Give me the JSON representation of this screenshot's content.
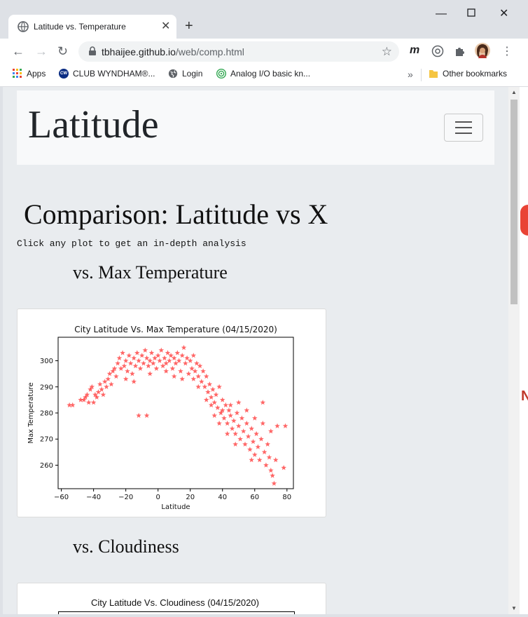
{
  "browser": {
    "tab_title": "Latitude vs. Temperature",
    "url_host": "tbhaijee.github.io",
    "url_path": "/web/comp.html",
    "bookmarks": [
      "Apps",
      "CLUB WYNDHAM®...",
      "Login",
      "Analog I/O basic kn..."
    ],
    "other_bookmarks": "Other bookmarks",
    "overflow": "»",
    "cw_badge": "CW"
  },
  "page": {
    "brand": "Latitude",
    "heading": "Comparison: Latitude vs X",
    "hint": "Click any plot to get an in-depth analysis",
    "section1": "vs. Max Temperature",
    "section2": "vs. Cloudiness",
    "plot2_title": "City Latitude Vs. Cloudiness (04/15/2020)"
  },
  "chart_data": {
    "type": "scatter",
    "title": "City Latitude Vs. Max Temperature (04/15/2020)",
    "xlabel": "Latitude",
    "ylabel": "Max Temperature",
    "xlim": [
      -62,
      84
    ],
    "ylim": [
      251,
      309
    ],
    "xticks": [
      -60,
      -40,
      -20,
      0,
      20,
      40,
      60,
      80
    ],
    "yticks": [
      260,
      270,
      280,
      290,
      300
    ],
    "marker": "star",
    "color": "#ff0000",
    "points": [
      [
        -55,
        283
      ],
      [
        -53,
        283
      ],
      [
        -46,
        285
      ],
      [
        -45,
        286
      ],
      [
        -44,
        287
      ],
      [
        -42,
        289
      ],
      [
        -41,
        290
      ],
      [
        -40,
        284
      ],
      [
        -38,
        286
      ],
      [
        -37,
        288
      ],
      [
        -36,
        291
      ],
      [
        -35,
        289
      ],
      [
        -34,
        287
      ],
      [
        -33,
        292
      ],
      [
        -32,
        290
      ],
      [
        -31,
        293
      ],
      [
        -30,
        295
      ],
      [
        -29,
        291
      ],
      [
        -28,
        296
      ],
      [
        -27,
        297
      ],
      [
        -26,
        294
      ],
      [
        -25,
        299
      ],
      [
        -24,
        301
      ],
      [
        -23,
        297
      ],
      [
        -22,
        303
      ],
      [
        -21,
        298
      ],
      [
        -20,
        300
      ],
      [
        -19,
        296
      ],
      [
        -18,
        302
      ],
      [
        -17,
        299
      ],
      [
        -16,
        295
      ],
      [
        -15,
        301
      ],
      [
        -14,
        298
      ],
      [
        -13,
        303
      ],
      [
        -12,
        300
      ],
      [
        -11,
        297
      ],
      [
        -10,
        302
      ],
      [
        -9,
        299
      ],
      [
        -8,
        304
      ],
      [
        -7,
        301
      ],
      [
        -6,
        298
      ],
      [
        -5,
        300
      ],
      [
        -4,
        303
      ],
      [
        -3,
        299
      ],
      [
        -2,
        301
      ],
      [
        -1,
        297
      ],
      [
        0,
        302
      ],
      [
        1,
        300
      ],
      [
        2,
        304
      ],
      [
        3,
        298
      ],
      [
        4,
        301
      ],
      [
        5,
        299
      ],
      [
        6,
        303
      ],
      [
        7,
        300
      ],
      [
        8,
        302
      ],
      [
        9,
        297
      ],
      [
        10,
        301
      ],
      [
        11,
        299
      ],
      [
        12,
        303
      ],
      [
        13,
        300
      ],
      [
        14,
        296
      ],
      [
        15,
        302
      ],
      [
        16,
        305
      ],
      [
        17,
        299
      ],
      [
        18,
        301
      ],
      [
        19,
        295
      ],
      [
        20,
        300
      ],
      [
        21,
        297
      ],
      [
        22,
        302
      ],
      [
        23,
        296
      ],
      [
        24,
        299
      ],
      [
        25,
        294
      ],
      [
        26,
        298
      ],
      [
        27,
        292
      ],
      [
        28,
        296
      ],
      [
        29,
        290
      ],
      [
        30,
        294
      ],
      [
        31,
        288
      ],
      [
        32,
        291
      ],
      [
        33,
        286
      ],
      [
        34,
        289
      ],
      [
        35,
        284
      ],
      [
        36,
        287
      ],
      [
        37,
        282
      ],
      [
        38,
        290
      ],
      [
        39,
        280
      ],
      [
        40,
        285
      ],
      [
        41,
        278
      ],
      [
        42,
        283
      ],
      [
        43,
        276
      ],
      [
        44,
        281
      ],
      [
        45,
        279
      ],
      [
        46,
        274
      ],
      [
        47,
        277
      ],
      [
        48,
        272
      ],
      [
        49,
        280
      ],
      [
        50,
        275
      ],
      [
        51,
        270
      ],
      [
        52,
        278
      ],
      [
        53,
        273
      ],
      [
        54,
        268
      ],
      [
        55,
        276
      ],
      [
        56,
        271
      ],
      [
        57,
        266
      ],
      [
        58,
        274
      ],
      [
        59,
        269
      ],
      [
        60,
        264
      ],
      [
        61,
        272
      ],
      [
        62,
        267
      ],
      [
        63,
        262
      ],
      [
        64,
        270
      ],
      [
        65,
        284
      ],
      [
        66,
        265
      ],
      [
        67,
        260
      ],
      [
        68,
        268
      ],
      [
        69,
        263
      ],
      [
        70,
        258
      ],
      [
        71,
        256
      ],
      [
        72,
        253
      ],
      [
        73,
        262
      ],
      [
        74,
        275
      ],
      [
        78,
        259
      ],
      [
        79,
        275
      ],
      [
        -12,
        279
      ],
      [
        -7,
        279
      ],
      [
        -48,
        285
      ],
      [
        -43,
        284
      ],
      [
        -39,
        287
      ],
      [
        15,
        293
      ],
      [
        22,
        293
      ],
      [
        30,
        285
      ],
      [
        35,
        279
      ],
      [
        40,
        281
      ],
      [
        45,
        283
      ],
      [
        55,
        281
      ],
      [
        60,
        278
      ],
      [
        65,
        276
      ],
      [
        70,
        273
      ],
      [
        50,
        284
      ],
      [
        43,
        272
      ],
      [
        -20,
        293
      ],
      [
        -15,
        292
      ],
      [
        -5,
        295
      ],
      [
        5,
        296
      ],
      [
        10,
        294
      ],
      [
        25,
        290
      ],
      [
        33,
        283
      ],
      [
        38,
        276
      ],
      [
        48,
        268
      ],
      [
        58,
        262
      ]
    ]
  },
  "colors": {
    "page_bg": "#e9ecef",
    "navbar_bg": "#f8f9fa",
    "marker": "#ff0000"
  }
}
